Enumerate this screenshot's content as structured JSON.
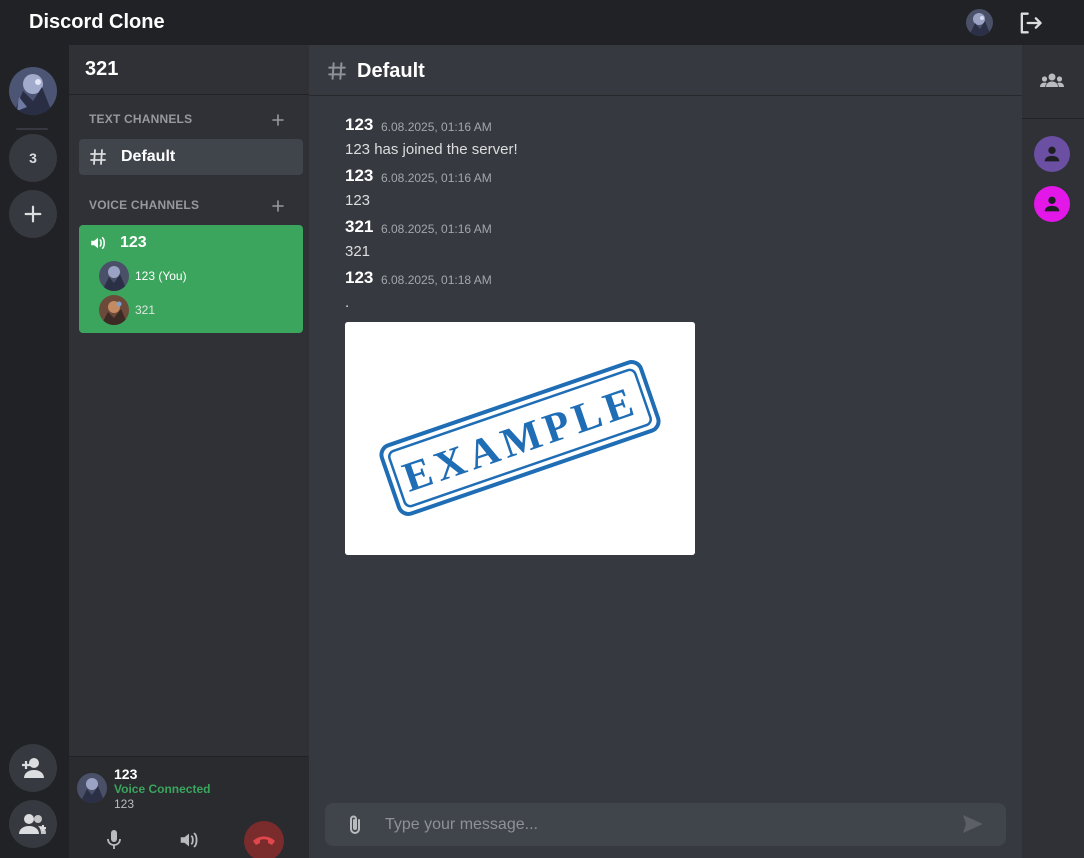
{
  "app": {
    "title": "Discord Clone"
  },
  "rail": {
    "server_count": "3"
  },
  "server": {
    "name": "321"
  },
  "categories": {
    "text": "TEXT CHANNELS",
    "voice": "VOICE CHANNELS"
  },
  "text_channels": [
    {
      "name": "Default"
    }
  ],
  "voice_channel": {
    "name": "123",
    "users": [
      {
        "name": "123 (You)"
      },
      {
        "name": "321"
      }
    ]
  },
  "user_panel": {
    "name": "123",
    "status": "Voice Connected",
    "channel": "123"
  },
  "chat": {
    "channel_title": "Default",
    "messages": [
      {
        "author": "123",
        "time": "6.08.2025, 01:16 AM",
        "content": "123 has joined the server!"
      },
      {
        "author": "123",
        "time": "6.08.2025, 01:16 AM",
        "content": "123"
      },
      {
        "author": "321",
        "time": "6.08.2025, 01:16 AM",
        "content": "321"
      },
      {
        "author": "123",
        "time": "6.08.2025, 01:18 AM",
        "content": "."
      }
    ],
    "attachment_text": "EXAMPLE"
  },
  "composer": {
    "placeholder": "Type your message..."
  },
  "colors": {
    "voice_active": "#3ba55d",
    "member_1": "#6a4fa3",
    "member_2": "#e317e8",
    "stamp_blue": "#1f6db5",
    "hangup": "#e0474c"
  },
  "icons": [
    "logout-icon",
    "plus-icon",
    "add-friend-icon",
    "group-icon",
    "hash-icon",
    "speaker-icon",
    "mic-icon",
    "volume-icon",
    "hangup-icon",
    "paperclip-icon",
    "send-icon",
    "members-icon",
    "person-icon"
  ]
}
